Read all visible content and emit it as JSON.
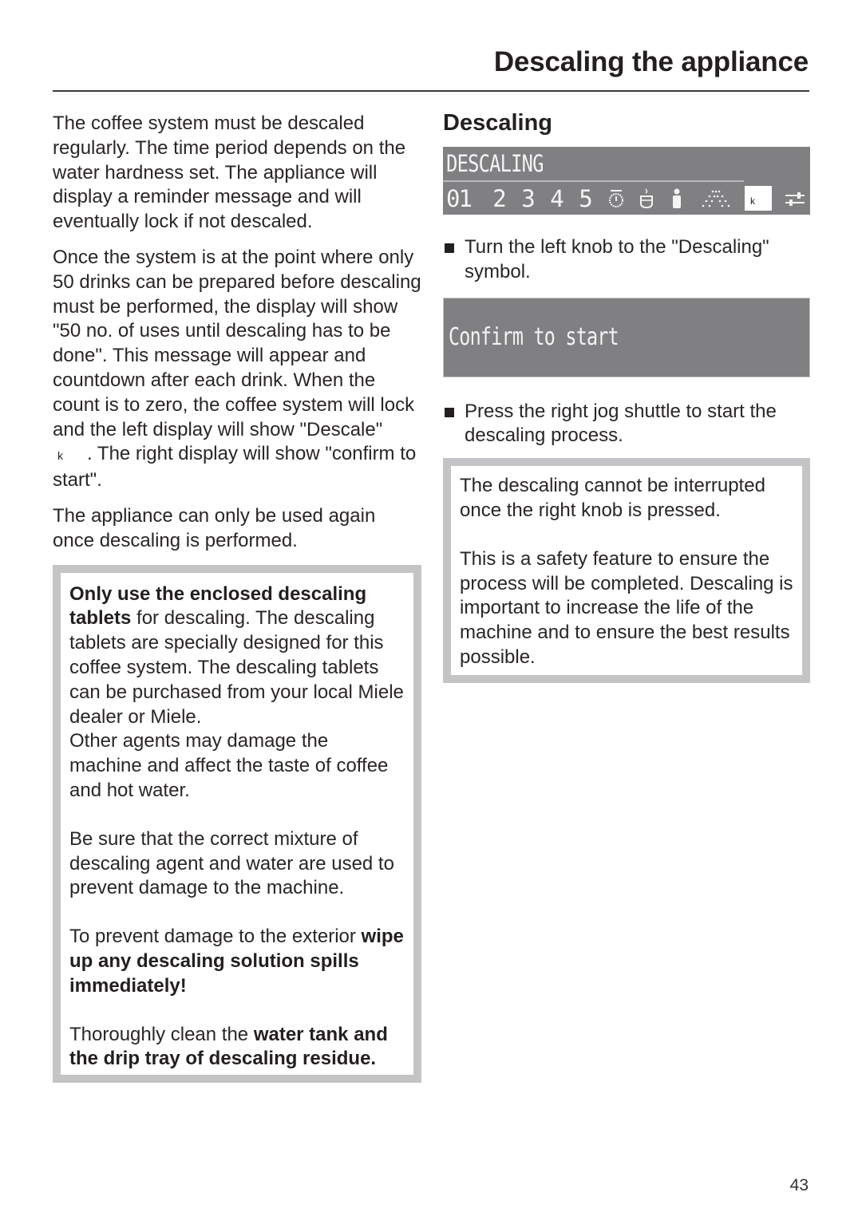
{
  "header": {
    "title": "Descaling the appliance"
  },
  "left": {
    "paragraphs": [
      "The coffee system must be descaled regularly. The time period depends on the water hardness set. The appliance will display a reminder message and will eventually lock if not descaled.",
      "Once the system is at the point where only 50 drinks can be prepared before descaling must be performed, the display will show \"50 no. of uses until descaling has to be done\". This message will appear and countdown after each drink. When the count is to zero, the coffee system will lock and the left display will show \"Descale\"",
      ". The right display will show \"confirm to start\".",
      "The appliance can only be used again once descaling is performed."
    ],
    "inline_symbol": "k",
    "warning": {
      "p1_bold": "Only use the enclosed descaling tablets",
      "p1_rest": " for descaling. The descaling tablets are specially designed for this coffee system. The descaling tablets can be purchased from your local Miele dealer or Miele.",
      "p1_second": "Other agents may damage the machine and affect the taste of coffee and hot water.",
      "p2": "Be sure that the correct mixture of descaling agent and water are used to prevent damage to the machine.",
      "p3_plain": "To prevent damage to the exterior ",
      "p3_bold": "wipe up any descaling solution spills immediately!",
      "p4_plain": "Thoroughly clean the ",
      "p4_bold": "water tank and the drip tray of descaling residue."
    }
  },
  "right": {
    "heading": "Descaling",
    "lcd": {
      "top_text": "DESCALING",
      "numbers": [
        "01",
        "2",
        "3",
        "4",
        "5"
      ],
      "icons": [
        "power-timer-icon",
        "cup-icon",
        "person-icon",
        "spray-icon",
        "descale-symbol-icon",
        "settings-sliders-icon"
      ],
      "selected_symbol": "k"
    },
    "step1": "Turn the left knob to the \"Descaling\" symbol.",
    "confirm_display": "Confirm to start",
    "step2": "Press the right jog shuttle to start the descaling process.",
    "info": {
      "p1": "The descaling cannot be interrupted once the right knob is pressed.",
      "p2": "This is a safety feature to ensure the process will be completed. Descaling is important to increase the life of the machine and to ensure the best results possible."
    }
  },
  "footer": {
    "page_number": "43"
  }
}
